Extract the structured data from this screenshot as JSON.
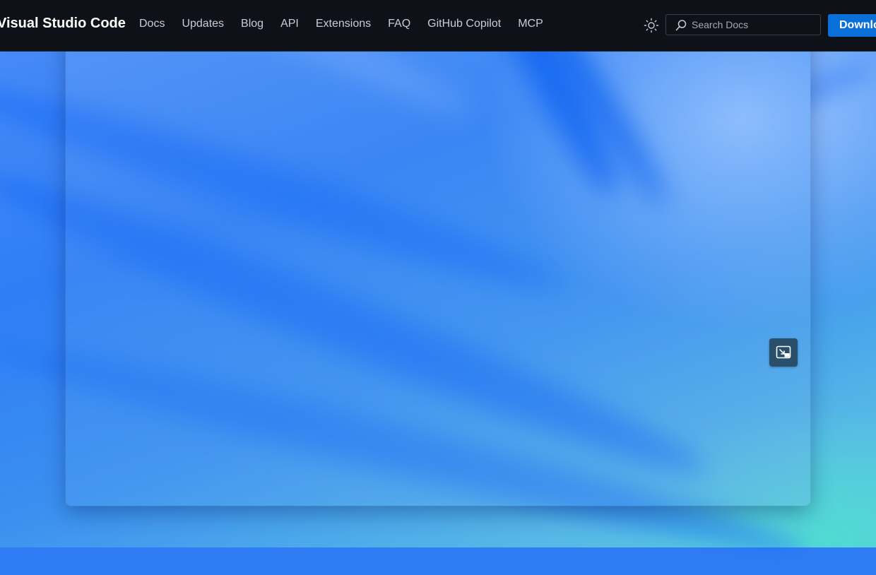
{
  "header": {
    "brand": "Visual Studio Code",
    "nav": [
      "Docs",
      "Updates",
      "Blog",
      "API",
      "Extensions",
      "FAQ",
      "GitHub Copilot",
      "MCP"
    ],
    "theme_icon": "sun-icon",
    "search": {
      "placeholder": "Search Docs",
      "icon": "search-icon"
    },
    "download_label": "Download"
  },
  "video": {
    "pip_icon": "picture-in-picture-icon"
  },
  "colors": {
    "header_bg": "#0e1117",
    "accent": "#0a6fd8",
    "pip_bg": "#2a4f6b"
  }
}
